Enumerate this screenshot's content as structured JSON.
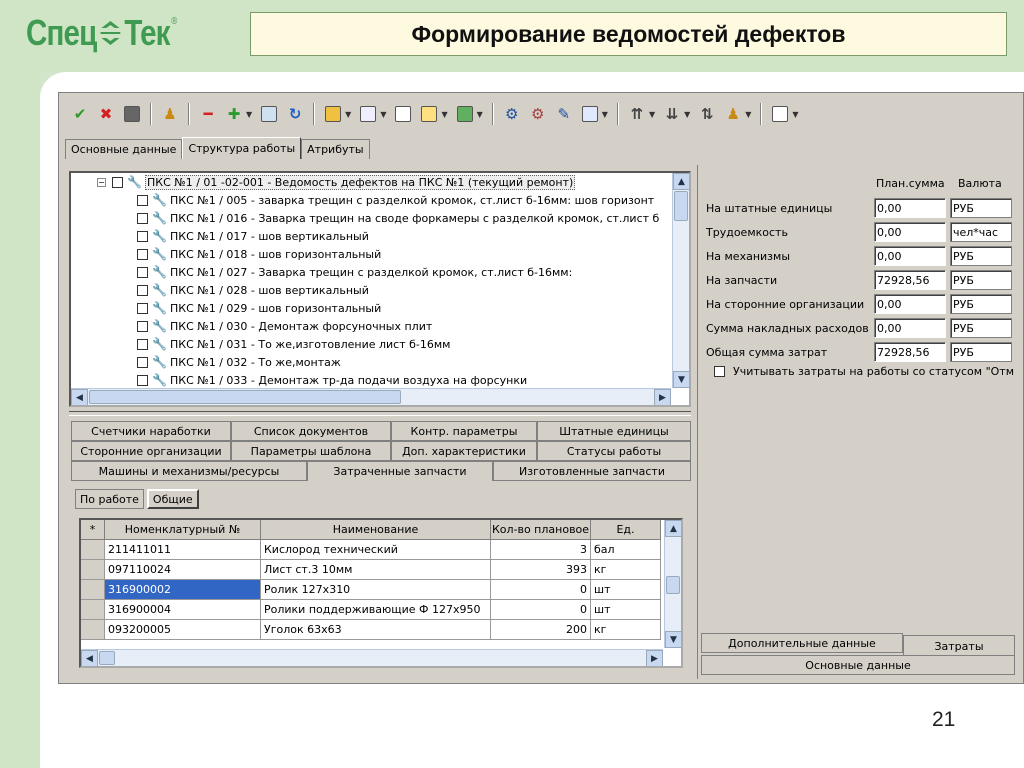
{
  "slide": {
    "title": "Формирование ведомостей дефектов",
    "page_number": "21",
    "logo_text_left": "Спец",
    "logo_text_right": "Тек",
    "logo_reg": "®",
    "colors": {
      "background": "#cfe5c6",
      "logo_green": "#3f9a52",
      "title_bg": "#fefae0"
    }
  },
  "toolbar": {
    "buttons": [
      "check-icon",
      "close-icon",
      "save-icon",
      "users-icon",
      "minus-icon",
      "plus-icon",
      "copy-icon",
      "refresh-icon",
      "edit-icon",
      "list-icon",
      "document-icon",
      "export-icon",
      "report-icon",
      "settings-icon",
      "tools-icon",
      "print-icon",
      "preview-icon",
      "move-up-icon",
      "move-down-icon",
      "move-icon",
      "user-edit-icon",
      "window-icon"
    ]
  },
  "main_tabs": [
    "Основные данные",
    "Структура работы",
    "Атрибуты"
  ],
  "tree": {
    "root": "ПКС №1 / 01 -02-001 - Ведомость дефектов на ПКС №1 (текущий ремонт)",
    "items": [
      "ПКС №1 / 005 - заварка трещин с разделкой кромок, ст.лист б-16мм:   шов горизонт",
      "ПКС №1 / 016 - Заварка трещин  на своде форкамеры с разделкой кромок, ст.лист б",
      "ПКС №1 / 017 - шов вертикальный",
      "ПКС №1 / 018 - шов горизонтальный",
      "ПКС №1 / 027 - Заварка трещин с разделкой кромок, ст.лист б-16мм:",
      "ПКС №1 / 028 - шов вертикальный",
      "ПКС №1 / 029 - шов горизонтальный",
      "ПКС №1 / 030 - Демонтаж форсуночных плит",
      "ПКС №1 / 031 - То же,изготовление лист б-16мм",
      "ПКС №1 / 032 - То же,монтаж",
      "ПКС №1 / 033 - Демонтаж тр-да подачи воздуха на форсунки"
    ]
  },
  "mid_tabs": {
    "row1": [
      "Счетчики наработки",
      "Список документов",
      "Контр. параметры",
      "Штатные единицы"
    ],
    "row2": [
      "Сторонние организации",
      "Параметры шаблона",
      "Доп. характеристики",
      "Статусы работы"
    ],
    "row3": [
      "Машины и механизмы/ресурсы",
      "Затраченные запчасти",
      "Изготовленные запчасти"
    ]
  },
  "sub_tabs": [
    "По работе",
    "Общие"
  ],
  "grid": {
    "columns": [
      "*",
      "Номенклатурный №",
      "Наименование",
      "Кол-во плановое",
      "Ед."
    ],
    "rows": [
      [
        "",
        "211411011",
        "Кислород технический",
        "3",
        "бал"
      ],
      [
        "",
        "097110024",
        "Лист ст.3 10мм",
        "393",
        "кг"
      ],
      [
        "",
        "316900002",
        "Ролик 127х310",
        "0",
        "шт"
      ],
      [
        "",
        "316900004",
        "Ролики поддерживающие Ф 127х950",
        "0",
        "шт"
      ],
      [
        "",
        "093200005",
        "Уголок 63х63",
        "200",
        "кг"
      ]
    ],
    "selected_row": 2
  },
  "costs": {
    "header_plan": "План.сумма",
    "header_currency": "Валюта",
    "rows": [
      {
        "label": "На штатные единицы",
        "value": "0,00",
        "unit": "РУБ"
      },
      {
        "label": "Трудоемкость",
        "value": "0,00",
        "unit": "чел*час"
      },
      {
        "label": "На механизмы",
        "value": "0,00",
        "unit": "РУБ"
      },
      {
        "label": "На запчасти",
        "value": "72928,56",
        "unit": "РУБ"
      },
      {
        "label": "На сторонние организации",
        "value": "0,00",
        "unit": "РУБ"
      },
      {
        "label": "Сумма накладных расходов",
        "value": "0,00",
        "unit": "РУБ"
      },
      {
        "label": "Общая сумма затрат",
        "value": "72928,56",
        "unit": "РУБ"
      }
    ],
    "checkbox_label": "Учитывать затраты на работы со статусом \"Отм"
  },
  "bottom_tabs": [
    "Дополнительные данные",
    "Затраты",
    "Основные данные"
  ]
}
